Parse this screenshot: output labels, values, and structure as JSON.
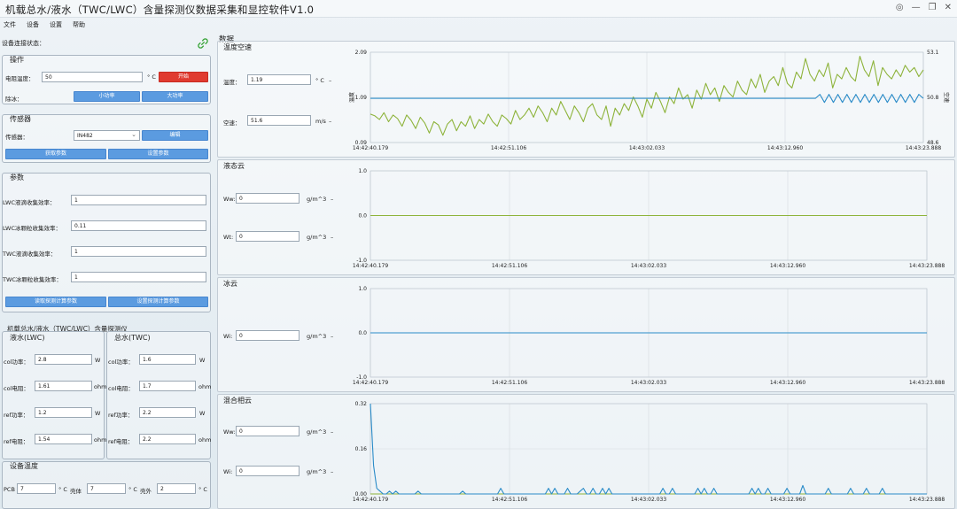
{
  "window": {
    "title": "机载总水/液水（TWC/LWC）含量探测仪数据采集和显控软件V1.0",
    "controls": [
      "◎",
      "—",
      "❐",
      "✕"
    ]
  },
  "menu": [
    "文件",
    "设备",
    "设置",
    "帮助"
  ],
  "connection": {
    "label": "设备连接状态："
  },
  "operation": {
    "title": "操作",
    "heater_label": "电阻温度：",
    "heater_value": "50",
    "heater_unit": "° C",
    "start_label": "开始",
    "deice_label": "除冰：",
    "low_power_label": "小功率",
    "high_power_label": "大功率"
  },
  "sensor": {
    "title": "传感器",
    "sensor_label": "传感器：",
    "sensor_value": "IN482",
    "edit_label": "编辑",
    "get_params_label": "获取参数",
    "set_params_label": "设置参数"
  },
  "params": {
    "title": "参数",
    "fields": [
      {
        "label": "LWC液滴收集效率：",
        "value": "1"
      },
      {
        "label": "LWC冰颗粒收集效率：",
        "value": "0.11"
      },
      {
        "label": "TWC液滴收集效率：",
        "value": "1"
      },
      {
        "label": "TWC冰颗粒收集效率：",
        "value": "1"
      }
    ],
    "read_label": "读取探测计算参数",
    "set_label": "设置探测计算参数"
  },
  "probe": {
    "title": "机载总水/液水（TWC/LWC）含量探测仪",
    "lwc": {
      "title": "液水(LWC)",
      "rows": [
        {
          "label": "col功率：",
          "value": "2.8",
          "unit": "W"
        },
        {
          "label": "col电阻：",
          "value": "1.61",
          "unit": "ohm"
        },
        {
          "label": "ref功率：",
          "value": "1.2",
          "unit": "W"
        },
        {
          "label": "ref电阻：",
          "value": "1.54",
          "unit": "ohm"
        }
      ]
    },
    "twc": {
      "title": "总水(TWC)",
      "rows": [
        {
          "label": "col功率：",
          "value": "1.6",
          "unit": "W"
        },
        {
          "label": "col电阻：",
          "value": "1.7",
          "unit": "ohm"
        },
        {
          "label": "ref功率：",
          "value": "2.2",
          "unit": "W"
        },
        {
          "label": "ref电阻：",
          "value": "2.2",
          "unit": "ohm"
        }
      ]
    }
  },
  "device_temp": {
    "title": "设备温度",
    "items": [
      {
        "label": "PCB",
        "value": "7",
        "unit": "° C"
      },
      {
        "label": "壳体",
        "value": "7",
        "unit": "° C"
      },
      {
        "label": "壳外",
        "value": "2",
        "unit": "° C"
      }
    ]
  },
  "data_section": {
    "title": "数据"
  },
  "panels": {
    "temp_speed": {
      "title": "温度空速",
      "temp_label": "温度：",
      "temp_value": "1.19",
      "temp_unit": "° C",
      "speed_label": "空速：",
      "speed_value": "51.6",
      "speed_unit": "m/s"
    },
    "liquid_cloud": {
      "title": "液态云",
      "ww_label": "Ww:",
      "ww_value": "0",
      "ww_unit": "g/m^3",
      "wt_label": "Wt:",
      "wt_value": "0",
      "wt_unit": "g/m^3"
    },
    "ice_cloud": {
      "title": "冰云",
      "wi_label": "Wi:",
      "wi_value": "0",
      "wi_unit": "g/m^3"
    },
    "mixed_cloud": {
      "title": "混合相云",
      "ww_label": "Ww:",
      "ww_value": "0",
      "ww_unit": "g/m^3",
      "wi_label": "Wi:",
      "wi_value": "0",
      "wi_unit": "g/m^3"
    }
  },
  "colors": {
    "green_series": "#8db33a",
    "blue_series": "#2a8bc8",
    "start_button": "#e03a2f",
    "button": "#5b9be0"
  },
  "chart_data": [
    {
      "type": "line",
      "panel": "温度空速",
      "x_ticks": [
        "14:42:40.179",
        "14:42:51.106",
        "14:43:02.033",
        "14:43:12.960",
        "14:43:23.888"
      ],
      "left_axis": {
        "ylim": [
          0.09,
          2.09
        ],
        "ticks": [
          "2.09",
          "1.09",
          "0.09"
        ],
        "label": "温度"
      },
      "right_axis": {
        "ylim": [
          48.6,
          53.1
        ],
        "ticks": [
          "53.1",
          "50.8",
          "48.6"
        ],
        "label": "空速"
      },
      "series": [
        {
          "name": "温度",
          "axis": "left",
          "color": "#8db33a",
          "values": [
            0.72,
            0.68,
            0.6,
            0.75,
            0.55,
            0.7,
            0.62,
            0.45,
            0.7,
            0.58,
            0.4,
            0.65,
            0.52,
            0.3,
            0.55,
            0.48,
            0.25,
            0.5,
            0.6,
            0.35,
            0.55,
            0.45,
            0.68,
            0.4,
            0.6,
            0.5,
            0.72,
            0.55,
            0.45,
            0.7,
            0.62,
            0.5,
            0.8,
            0.6,
            0.7,
            0.85,
            0.65,
            0.9,
            0.75,
            0.55,
            0.85,
            0.7,
            1.0,
            0.8,
            0.6,
            0.9,
            0.75,
            0.55,
            0.85,
            0.95,
            0.7,
            0.6,
            0.9,
            0.45,
            0.85,
            0.7,
            0.95,
            0.8,
            1.1,
            0.9,
            0.65,
            1.05,
            0.85,
            1.2,
            1.0,
            0.75,
            1.1,
            0.95,
            1.3,
            1.05,
            1.15,
            0.85,
            1.25,
            1.05,
            1.4,
            1.15,
            1.3,
            1.0,
            1.35,
            1.2,
            1.1,
            1.45,
            1.25,
            1.15,
            1.5,
            1.3,
            1.6,
            1.2,
            1.45,
            1.55,
            1.35,
            1.75,
            1.4,
            1.3,
            1.65,
            1.5,
            1.95,
            1.6,
            1.45,
            1.7,
            1.55,
            1.85,
            1.3,
            1.6,
            1.5,
            1.75,
            1.55,
            1.45,
            2.0,
            1.7,
            1.55,
            1.9,
            1.35,
            1.75,
            1.6,
            1.5,
            1.7,
            1.55,
            1.8,
            1.65,
            1.75,
            1.55,
            1.7
          ]
        },
        {
          "name": "空速",
          "axis": "right",
          "color": "#2a8bc8",
          "values": [
            50.8,
            50.8,
            50.8,
            50.8,
            50.8,
            50.8,
            50.8,
            50.8,
            50.8,
            50.8,
            50.8,
            50.8,
            50.8,
            50.8,
            50.8,
            50.8,
            50.8,
            50.8,
            50.8,
            50.8,
            50.8,
            50.8,
            50.8,
            50.8,
            50.8,
            50.8,
            50.8,
            50.8,
            50.8,
            50.8,
            50.8,
            50.8,
            50.8,
            50.8,
            50.8,
            50.8,
            50.8,
            50.8,
            50.8,
            50.8,
            50.8,
            50.8,
            50.8,
            50.8,
            50.8,
            50.8,
            50.8,
            50.8,
            50.8,
            50.8,
            50.8,
            50.8,
            50.8,
            50.8,
            50.8,
            50.8,
            50.8,
            50.8,
            50.8,
            50.8,
            50.8,
            50.8,
            50.8,
            50.8,
            50.8,
            50.8,
            50.8,
            50.8,
            50.8,
            50.8,
            50.8,
            50.8,
            50.8,
            50.8,
            50.8,
            50.8,
            50.8,
            50.8,
            50.8,
            50.8,
            50.8,
            50.8,
            50.8,
            50.8,
            50.8,
            50.8,
            50.8,
            50.8,
            50.8,
            50.8,
            50.8,
            50.8,
            50.8,
            50.8,
            50.8,
            50.8,
            50.8,
            50.8,
            50.8,
            50.8,
            51.0,
            50.6,
            51.0,
            50.6,
            51.0,
            50.6,
            51.0,
            50.6,
            51.0,
            50.6,
            51.0,
            50.6,
            51.0,
            50.6,
            51.0,
            50.6,
            51.0,
            50.6,
            51.0,
            50.6,
            51.0,
            50.6,
            51.0,
            50.8
          ]
        }
      ]
    },
    {
      "type": "line",
      "panel": "液态云",
      "x_ticks": [
        "14:42:40.179",
        "14:42:51.106",
        "14:43:02.033",
        "14:43:12.960",
        "14:43:23.888"
      ],
      "ylim": [
        -1.0,
        1.0
      ],
      "y_ticks": [
        "1.0",
        "0.0",
        "-1.0"
      ],
      "series": [
        {
          "color": "#8db33a",
          "values": [
            0,
            0
          ]
        }
      ]
    },
    {
      "type": "line",
      "panel": "冰云",
      "x_ticks": [
        "14:42:40.179",
        "14:42:51.106",
        "14:43:02.033",
        "14:43:12.960",
        "14:43:23.888"
      ],
      "ylim": [
        -1.0,
        1.0
      ],
      "y_ticks": [
        "1.0",
        "0.0",
        "-1.0"
      ],
      "series": [
        {
          "color": "#2a8bc8",
          "values": [
            0,
            0
          ]
        }
      ]
    },
    {
      "type": "line",
      "panel": "混合相云",
      "x_ticks": [
        "14:42:40.179",
        "14:42:51.106",
        "14:43:02.033",
        "14:43:12.960",
        "14:43:23.888"
      ],
      "ylim": [
        0.0,
        0.32
      ],
      "y_ticks": [
        "0.32",
        "0.16",
        "0.00"
      ],
      "series": [
        {
          "color": "#8db33a",
          "values": [
            0.0,
            0.0
          ]
        },
        {
          "color": "#2a8bc8",
          "values": [
            0.32,
            0.1,
            0.02,
            0.01,
            0.0,
            0.0,
            0.01,
            0.0,
            0.01,
            0.0,
            0.0,
            0.0,
            0.0,
            0.0,
            0.0,
            0.01,
            0.0,
            0.0,
            0.0,
            0.0,
            0.0,
            0.0,
            0.0,
            0.0,
            0.0,
            0.0,
            0.0,
            0.0,
            0.0,
            0.01,
            0.0,
            0.0,
            0.0,
            0.0,
            0.0,
            0.0,
            0.0,
            0.0,
            0.0,
            0.0,
            0.0,
            0.02,
            0.0,
            0.0,
            0.0,
            0.0,
            0.0,
            0.0,
            0.0,
            0.0,
            0.0,
            0.0,
            0.0,
            0.0,
            0.0,
            0.0,
            0.02,
            0.0,
            0.02,
            0.0,
            0.0,
            0.0,
            0.02,
            0.0,
            0.0,
            0.0,
            0.01,
            0.02,
            0.0,
            0.0,
            0.02,
            0.0,
            0.0,
            0.02,
            0.0,
            0.02,
            0.0,
            0.0,
            0.0,
            0.0,
            0.0,
            0.0,
            0.0,
            0.0,
            0.0,
            0.0,
            0.0,
            0.0,
            0.0,
            0.0,
            0.0,
            0.0,
            0.02,
            0.0,
            0.0,
            0.02,
            0.0,
            0.0,
            0.0,
            0.0,
            0.0,
            0.0,
            0.0,
            0.02,
            0.0,
            0.02,
            0.0,
            0.0,
            0.02,
            0.0,
            0.0,
            0.0,
            0.0,
            0.0,
            0.0,
            0.0,
            0.0,
            0.0,
            0.0,
            0.0,
            0.02,
            0.0,
            0.02,
            0.0,
            0.0,
            0.02,
            0.0,
            0.0,
            0.0,
            0.0,
            0.0,
            0.02,
            0.0,
            0.0,
            0.0,
            0.0,
            0.03,
            0.0,
            0.0,
            0.0,
            0.0,
            0.0,
            0.0,
            0.0,
            0.02,
            0.0,
            0.0,
            0.0,
            0.0,
            0.0,
            0.0,
            0.02,
            0.0,
            0.0,
            0.0,
            0.0,
            0.02,
            0.0,
            0.0,
            0.0,
            0.0,
            0.02,
            0.0,
            0.0,
            0.0,
            0.0,
            0.0,
            0.0,
            0.0,
            0.0,
            0.0,
            0.0,
            0.0,
            0.0,
            0.0,
            0.0
          ]
        }
      ]
    }
  ]
}
